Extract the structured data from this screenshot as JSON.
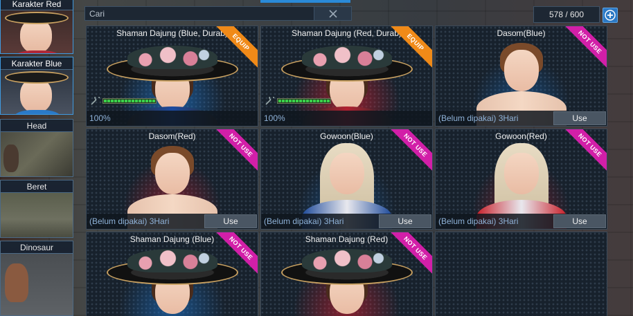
{
  "sidebar": {
    "categories": [
      {
        "label": "Karakter Red",
        "active": true
      },
      {
        "label": "Karakter Blue",
        "active": true
      },
      {
        "label": "Head",
        "active": false
      },
      {
        "label": "Beret",
        "active": false
      },
      {
        "label": "Dinosaur",
        "active": false
      }
    ]
  },
  "search": {
    "placeholder": "Cari",
    "clear_icon": "close-icon"
  },
  "inventory": {
    "count": "578 / 600",
    "add_icon": "plus-circle-icon"
  },
  "items": [
    {
      "name": "Shaman Dajung (Blue, Durab)",
      "ribbon": "EQUIP",
      "durability": "100%",
      "durability_fraction": 1.0,
      "theme": "blue",
      "kind": "shaman"
    },
    {
      "name": "Shaman Dajung (Red, Durab)",
      "ribbon": "EQUIP",
      "durability": "100%",
      "durability_fraction": 1.0,
      "theme": "red",
      "kind": "shaman"
    },
    {
      "name": "Dasom(Blue)",
      "ribbon": "NOT USE",
      "status": "(Belum dipakai) 3Hari",
      "button": "Use",
      "theme": "blue",
      "kind": "short"
    },
    {
      "name": "Dasom(Red)",
      "ribbon": "NOT USE",
      "status": "(Belum dipakai) 3Hari",
      "button": "Use",
      "theme": "red",
      "kind": "short"
    },
    {
      "name": "Gowoon(Blue)",
      "ribbon": "NOT USE",
      "status": "(Belum dipakai) 3Hari",
      "button": "Use",
      "theme": "blue",
      "kind": "long"
    },
    {
      "name": "Gowoon(Red)",
      "ribbon": "NOT USE",
      "status": "(Belum dipakai) 3Hari",
      "button": "Use",
      "theme": "red",
      "kind": "long"
    },
    {
      "name": "Shaman Dajung (Blue)",
      "ribbon": "NOT USE",
      "theme": "blue",
      "kind": "shaman"
    },
    {
      "name": "Shaman Dajung (Red)",
      "ribbon": "NOT USE",
      "theme": "red",
      "kind": "shaman"
    },
    {
      "name": "",
      "empty": true
    }
  ],
  "colors": {
    "equip_ribbon": "#f08a18",
    "notuse_ribbon": "#d21fa8",
    "status_text": "#8fb2d8",
    "blue_glow": "#1e6fc0",
    "red_glow": "#c02030"
  }
}
